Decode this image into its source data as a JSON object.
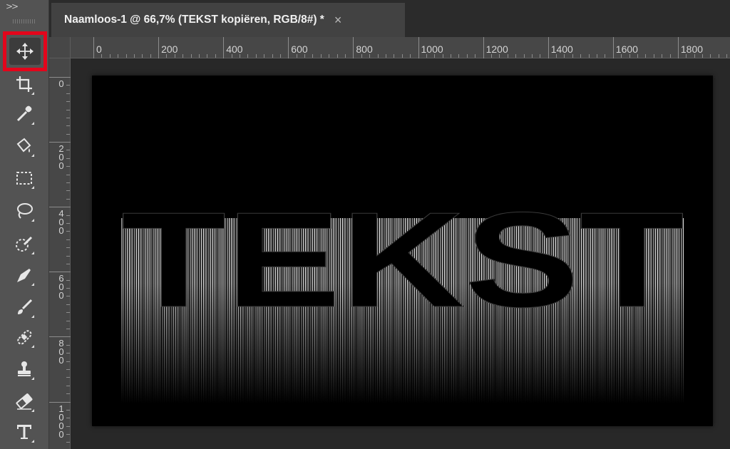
{
  "toolbar": {
    "collapse_label": ">>",
    "tools": [
      {
        "name": "move-tool",
        "icon": "move-icon",
        "selected": true
      },
      {
        "name": "crop-tool",
        "icon": "crop-icon"
      },
      {
        "name": "eyedropper-tool",
        "icon": "eyedropper-icon"
      },
      {
        "name": "paint-bucket-tool",
        "icon": "paint-bucket-icon"
      },
      {
        "name": "marquee-tool",
        "icon": "rectangular-marquee-icon"
      },
      {
        "name": "lasso-tool",
        "icon": "lasso-icon"
      },
      {
        "name": "quick-selection-tool",
        "icon": "quick-selection-icon"
      },
      {
        "name": "pen-tool",
        "icon": "pen-icon"
      },
      {
        "name": "brush-tool",
        "icon": "brush-icon"
      },
      {
        "name": "healing-brush-tool",
        "icon": "healing-bandage-icon"
      },
      {
        "name": "clone-stamp-tool",
        "icon": "stamp-icon"
      },
      {
        "name": "eraser-tool",
        "icon": "eraser-icon"
      },
      {
        "name": "type-tool",
        "icon": "type-icon"
      }
    ],
    "selected_highlight_color": "#e3051b"
  },
  "document_tab": {
    "title": "Naamloos-1 @ 66,7% (TEKST kopiëren, RGB/8#) *",
    "close_label": "×"
  },
  "rulers": {
    "horizontal_labels": [
      "0",
      "200",
      "400",
      "600",
      "800",
      "1000",
      "1200",
      "1400",
      "1600",
      "1800"
    ],
    "vertical_labels": [
      "0",
      "200",
      "400",
      "600",
      "800",
      "1000"
    ]
  },
  "canvas": {
    "text": "TEKST",
    "background": "#000000",
    "effect": "white-vertical-streaks"
  }
}
